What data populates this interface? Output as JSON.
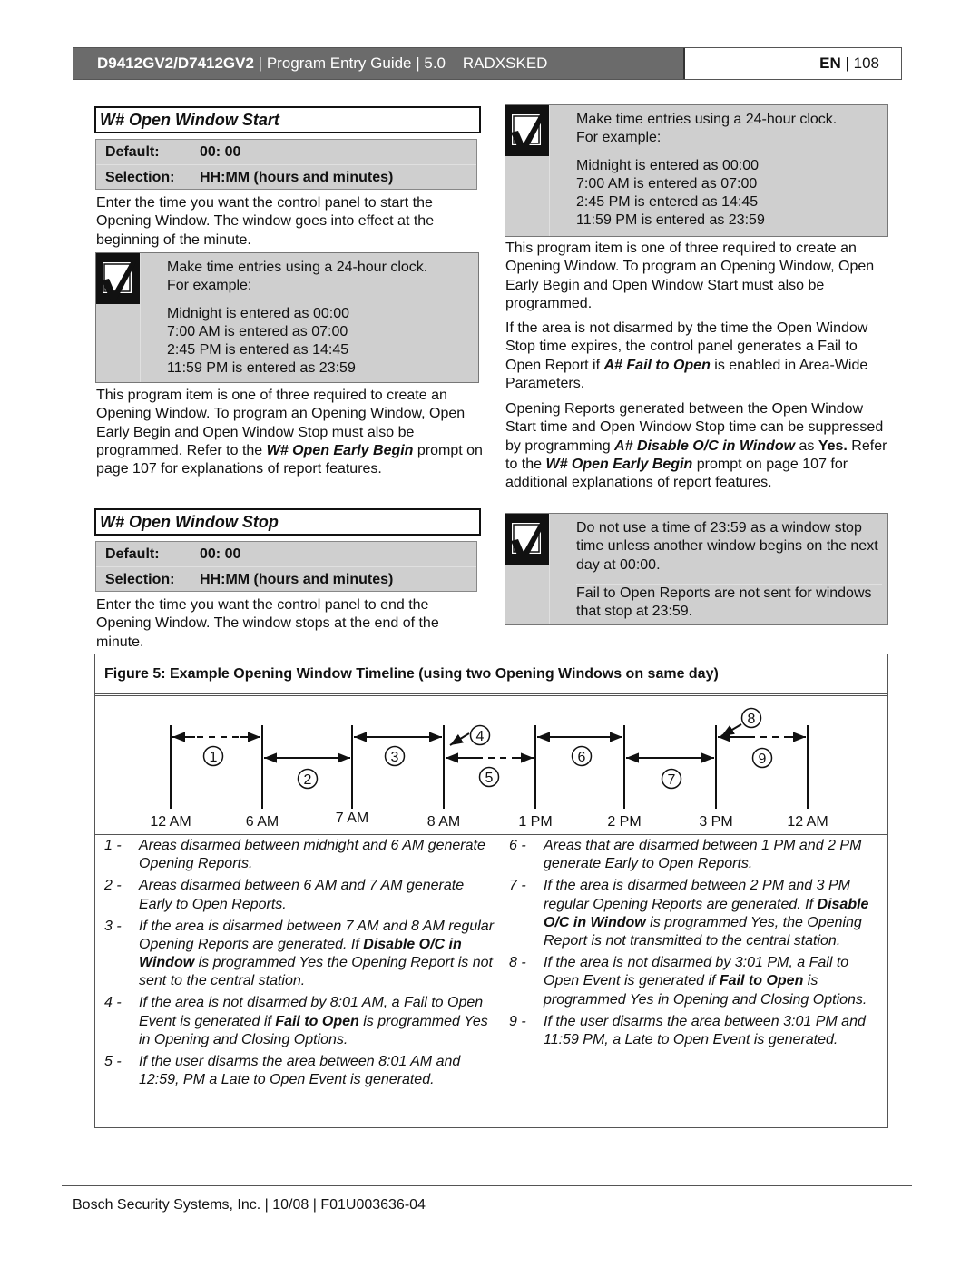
{
  "header": {
    "model": "D9412GV2/D7412GV2",
    "sep1": " | ",
    "guide": "Program Entry Guide | 5.0",
    "item": "RADXSKED",
    "lang": "EN",
    "sep2": " | ",
    "page": "108"
  },
  "start": {
    "title": "W# Open Window Start",
    "default_label": "Default:",
    "default_value": "00: 00",
    "selection_label": "Selection:",
    "selection_value": "HH:MM (hours and minutes)",
    "desc": "Enter the time you want the control panel to start the Opening Window. The window goes into effect at the beginning of the minute.",
    "note": {
      "line1": "Make time entries using a 24-hour clock.",
      "line2": "For example:",
      "examples": [
        "Midnight is entered as 00:00",
        "7:00 AM is entered as 07:00",
        "2:45 PM is entered as 14:45",
        "11:59 PM is entered as 23:59"
      ]
    },
    "para_a": "This program item is one of three required to create an Opening Window. To program an Opening Window, Open Early Begin and Open Window Stop must also be programmed. Refer to the ",
    "para_b": "W# Open Early Begin",
    "para_c": " prompt on page 107 for explanations of report features."
  },
  "stop": {
    "title": "W# Open Window Stop",
    "default_label": "Default:",
    "default_value": "00: 00",
    "selection_label": "Selection:",
    "selection_value": "HH:MM (hours and minutes)",
    "desc": "Enter the time you want the control panel to end the Opening Window. The window stops at the end of the minute."
  },
  "right": {
    "note": {
      "line1": "Make time entries using a 24-hour clock.",
      "line2": "For example:",
      "examples": [
        "Midnight is entered as 00:00",
        "7:00 AM is entered as 07:00",
        "2:45 PM is entered as 14:45",
        "11:59 PM is entered as 23:59"
      ]
    },
    "para1": "This program item is one of three required to create an Opening Window. To program an Opening Window, Open Early Begin and Open Window Start must also be programmed.",
    "para2_a": "If the area is not disarmed by the time the Open Window Stop time expires, the control panel generates a Fail to Open Report if ",
    "para2_b": "A# Fail to Open",
    "para2_c": " is enabled in Area-Wide Parameters.",
    "para3_a": "Opening Reports generated between the Open Window Start time and Open Window Stop time can be suppressed by programming ",
    "para3_b": "A# Disable O/C in Window",
    "para3_c": " as ",
    "para3_d": "Yes.",
    "para3_e": " Refer to the ",
    "para3_f": "W# Open Early Begin",
    "para3_g": " prompt on page 107 for additional explanations of report features.",
    "note2": {
      "text1": "Do not use a time of 23:59 as a window stop time unless another window begins on the next day at 00:00.",
      "text2": "Fail to Open Reports are not sent for windows that stop at 23:59."
    }
  },
  "figure": {
    "caption": "Figure 5: Example Opening Window Timeline (using two Opening Windows on same day)",
    "time_labels": [
      "12 AM",
      "6 AM",
      "7 AM",
      "8 AM",
      "1 PM",
      "2 PM",
      "3 PM",
      "12 AM"
    ],
    "markers": [
      "1",
      "2",
      "3",
      "4",
      "5",
      "6",
      "7",
      "8",
      "9"
    ],
    "legend_left": [
      {
        "num": "1 -",
        "parts": [
          {
            "t": "Areas disarmed between midnight and 6 AM generate Opening Reports."
          }
        ]
      },
      {
        "num": "2 -",
        "parts": [
          {
            "t": "Areas disarmed between 6 AM and 7 AM generate Early to Open Reports."
          }
        ]
      },
      {
        "num": "3 -",
        "parts": [
          {
            "t": "If the area is disarmed between 7 AM and 8 AM regular Opening Reports are generated. If "
          },
          {
            "t": "Disable O/C in Window",
            "b": true
          },
          {
            "t": " is programmed Yes the Opening Report is not sent to the central station."
          }
        ]
      },
      {
        "num": "4 -",
        "parts": [
          {
            "t": "If the area is not disarmed by 8:01 AM, a Fail to Open Event is generated if "
          },
          {
            "t": "Fail to Open",
            "b": true
          },
          {
            "t": " is programmed Yes in Opening and Closing Options."
          }
        ]
      },
      {
        "num": "5 -",
        "parts": [
          {
            "t": "If the user disarms the area between 8:01 AM and 12:59, PM a Late to Open Event is generated."
          }
        ]
      }
    ],
    "legend_right": [
      {
        "num": "6 -",
        "parts": [
          {
            "t": "Areas that are disarmed between 1 PM and 2 PM generate Early to Open Reports."
          }
        ]
      },
      {
        "num": "7 -",
        "parts": [
          {
            "t": "If the area is disarmed between 2 PM and 3 PM regular Opening Reports are generated. If "
          },
          {
            "t": "Disable O/C in Window",
            "b": true
          },
          {
            "t": " is programmed Yes, the Opening Report is not transmitted to the central station."
          }
        ]
      },
      {
        "num": "8 -",
        "parts": [
          {
            "t": "If the area is not disarmed by 3:01 PM, a Fail to Open Event is generated if "
          },
          {
            "t": "Fail to Open",
            "b": true
          },
          {
            "t": " is programmed Yes in Opening and Closing Options."
          }
        ]
      },
      {
        "num": "9 -",
        "parts": [
          {
            "t": "If the user disarms the area between 3:01 PM and 11:59 PM, a Late to Open Event is generated."
          }
        ]
      }
    ]
  },
  "footer": {
    "text": "Bosch Security Systems, Inc. | 10/08 | F01U003636-04"
  }
}
